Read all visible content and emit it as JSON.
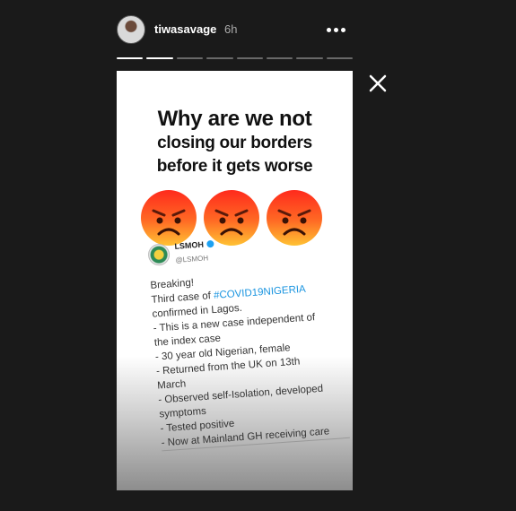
{
  "story": {
    "username": "tiwasavage",
    "time": "6h",
    "segments_total": 8,
    "segment_current": 2
  },
  "content": {
    "headline": [
      "Why are we not",
      "closing our borders",
      "before it gets worse"
    ],
    "tweet": {
      "name": "LSMOH",
      "handle": "@LSMOH",
      "line1": "Breaking!",
      "line2_prefix": "Third case of ",
      "hashtag": "#COVID19NIGERIA",
      "line3": "confirmed in Lagos.",
      "line4": "- This is a new case independent of",
      "line5": "the index case",
      "line6": "- 30 year old Nigerian, female",
      "line7": "- Returned from the UK on 13th",
      "line8": "March",
      "line9": "- Observed self-Isolation, developed",
      "line10": "symptoms",
      "line11": "- Tested positive",
      "line12": "- Now at Mainland GH receiving care"
    }
  },
  "icons": {
    "more": "more-options-icon",
    "close": "close-icon",
    "emoji": "angry-face-emoji"
  },
  "colors": {
    "background": "#1a1a1a",
    "hashtag": "#1b95e0",
    "emoji_top": "#ff2a1c",
    "emoji_bottom": "#ffc233"
  }
}
